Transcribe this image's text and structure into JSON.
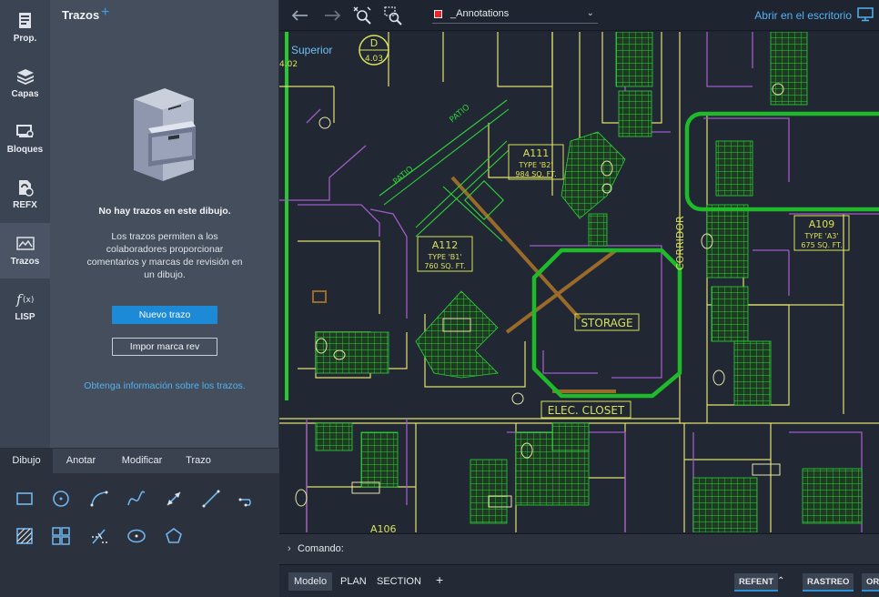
{
  "rail": {
    "items": [
      {
        "label": "Prop.",
        "icon": "properties-icon"
      },
      {
        "label": "Capas",
        "icon": "layers-icon"
      },
      {
        "label": "Bloques",
        "icon": "blocks-icon"
      },
      {
        "label": "REFX",
        "icon": "xref-icon"
      },
      {
        "label": "Trazos",
        "icon": "markups-icon"
      },
      {
        "label": "LISP",
        "icon": "lisp-icon"
      }
    ]
  },
  "panel": {
    "title": "Trazos",
    "add_symbol": "+",
    "empty_title": "No hay trazos en este dibujo.",
    "empty_description": "Los trazos permiten a los colaboradores proporcionar comentarios y marcas de revisión en un dibujo.",
    "new_button": "Nuevo trazo",
    "import_button": "Impor marca rev",
    "info_link": "Obtenga información sobre los trazos."
  },
  "palette": {
    "tabs": [
      "Dibujo",
      "Anotar",
      "Modificar",
      "Trazo"
    ],
    "active_tab": "Dibujo",
    "tools": [
      "rectangle-icon",
      "circle-icon",
      "arc-icon",
      "spline-icon",
      "dimension-icon",
      "line-icon",
      "polyline-icon",
      "hatch-icon",
      "array-icon",
      "trim-icon",
      "ellipse-icon",
      "polygon-icon"
    ]
  },
  "toolbar": {
    "layer_name": "_Annotations",
    "layer_color": "#e8242c",
    "open_desktop": "Abrir en el escritorio"
  },
  "canvas": {
    "view_label": "Superior",
    "labels": {
      "grid_letter": "D",
      "grid_sheet": "4.03",
      "grid_partial": "4.02",
      "patio_1": "PATIO",
      "patio_2": "PATIO",
      "a111_name": "A111",
      "a111_type": "TYPE 'B2'",
      "a111_area": "984 SQ. FT.",
      "a112_name": "A112",
      "a112_type": "TYPE 'B1'",
      "a112_area": "760 SQ. FT.",
      "a109_name": "A109",
      "a109_type": "TYPE 'A3'",
      "a109_area": "675 SQ. FT.",
      "storage": "STORAGE",
      "elec_closet": "ELEC. CLOSET",
      "corridor": "CORRIDOR",
      "a106_name": "A106"
    }
  },
  "command": {
    "label": "Comando:"
  },
  "status": {
    "layouts": [
      "Modelo",
      "PLAN",
      "SECTION"
    ],
    "active_layout": "Modelo",
    "add_symbol": "+",
    "toggles": [
      "REFENT",
      "RASTREO",
      "OR"
    ]
  }
}
